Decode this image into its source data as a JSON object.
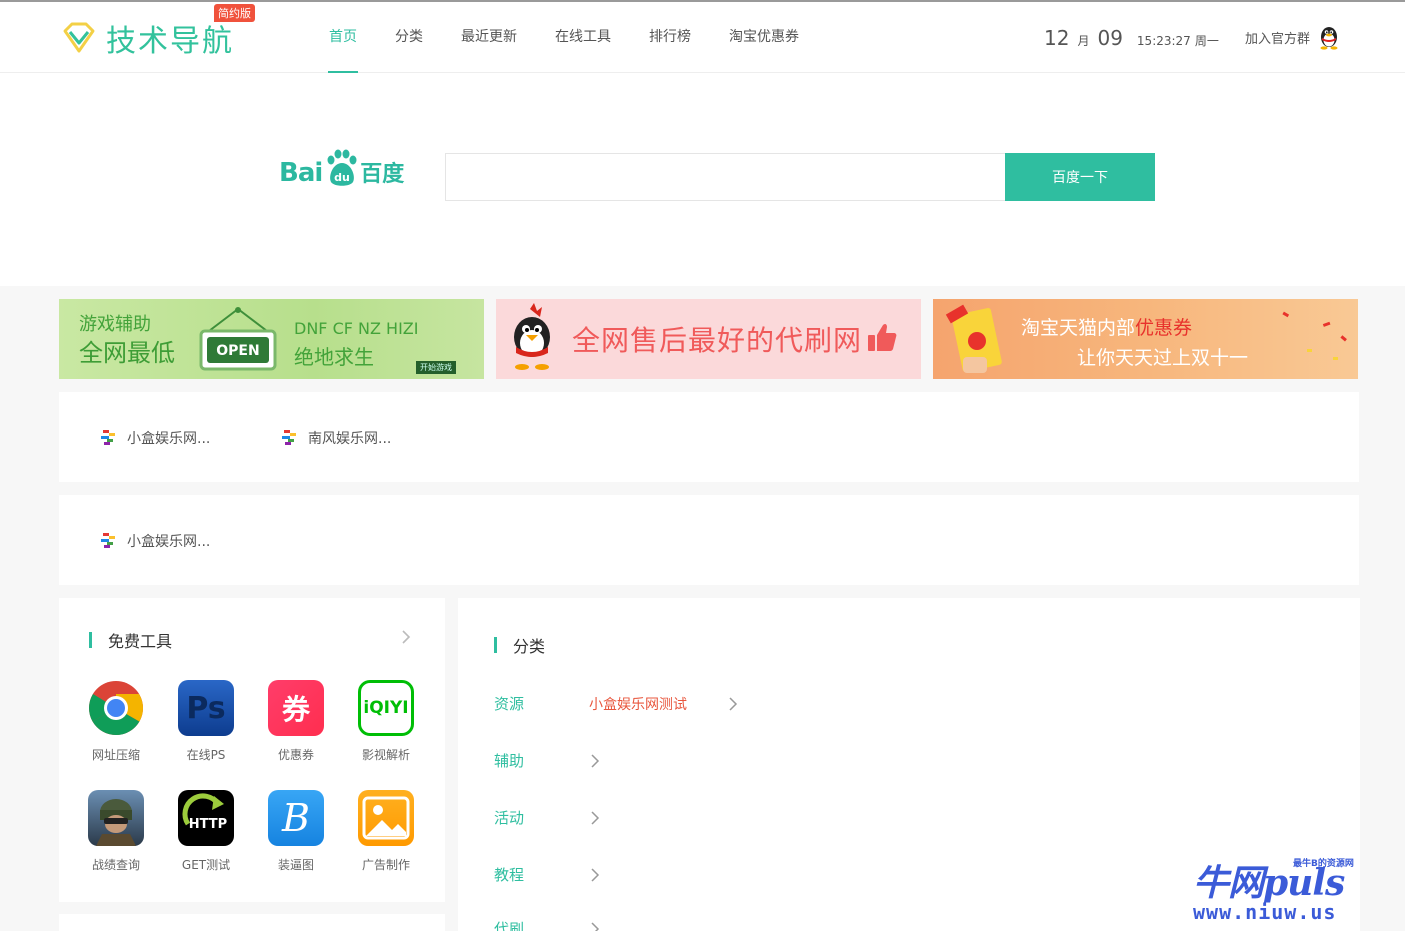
{
  "header": {
    "logo_text": "技术导航",
    "logo_badge": "简约版",
    "nav": [
      "首页",
      "分类",
      "最近更新",
      "在线工具",
      "排行榜",
      "淘宝优惠券"
    ],
    "clock": {
      "month": "12",
      "month_unit": "月",
      "day": "09",
      "time": "15:23:27",
      "weekday": "周一"
    },
    "join_label": "加入官方群"
  },
  "search": {
    "logo_bai": "Bai",
    "logo_du_small": "du",
    "logo_cn": "百度",
    "input_value": "",
    "button_label": "百度一下"
  },
  "banners": {
    "b1": {
      "line1": "游戏辅助",
      "line2": "全网最低",
      "sign": "OPEN",
      "right1": "DNF CF NZ HIZI",
      "right2": "绝地求生",
      "start": "开始游戏"
    },
    "b2": {
      "text": "全网售后最好的代刷网"
    },
    "b3": {
      "line1_pre": "淘宝天猫内部",
      "line1_hl": "优惠券",
      "line2": "让你天天过上双十一"
    }
  },
  "link_boxes": [
    {
      "items": [
        "小盒娱乐网...",
        "南风娱乐网..."
      ]
    },
    {
      "items": [
        "小盒娱乐网..."
      ]
    }
  ],
  "tools": {
    "title": "免费工具",
    "items": [
      {
        "label": "网址压缩",
        "icon": "chrome-icon"
      },
      {
        "label": "在线PS",
        "icon": "photoshop-icon"
      },
      {
        "label": "优惠券",
        "icon": "coupon-icon"
      },
      {
        "label": "影视解析",
        "icon": "iqiyi-icon"
      },
      {
        "label": "战绩查询",
        "icon": "pubg-icon"
      },
      {
        "label": "GET测试",
        "icon": "http-icon"
      },
      {
        "label": "装逼图",
        "icon": "b-icon"
      },
      {
        "label": "广告制作",
        "icon": "image-icon"
      }
    ],
    "icon_texts": {
      "ps": "Ps",
      "coupon": "券",
      "iqiyi": "iQIYI",
      "http": "HTTP",
      "b": "B"
    }
  },
  "categories": {
    "title": "分类",
    "rows": [
      {
        "name": "资源",
        "sub": "小盒娱乐网测试"
      },
      {
        "name": "辅助",
        "sub": ""
      },
      {
        "name": "活动",
        "sub": ""
      },
      {
        "name": "教程",
        "sub": ""
      },
      {
        "name": "代刷",
        "sub": ""
      }
    ]
  },
  "watermark": {
    "main": "牛网puls",
    "small": "最牛B的资源网",
    "url": "www.niuw.us"
  },
  "colors": {
    "accent": "#2fbea0",
    "highlight": "#e8573e",
    "watermark": "#3b5bd8"
  }
}
